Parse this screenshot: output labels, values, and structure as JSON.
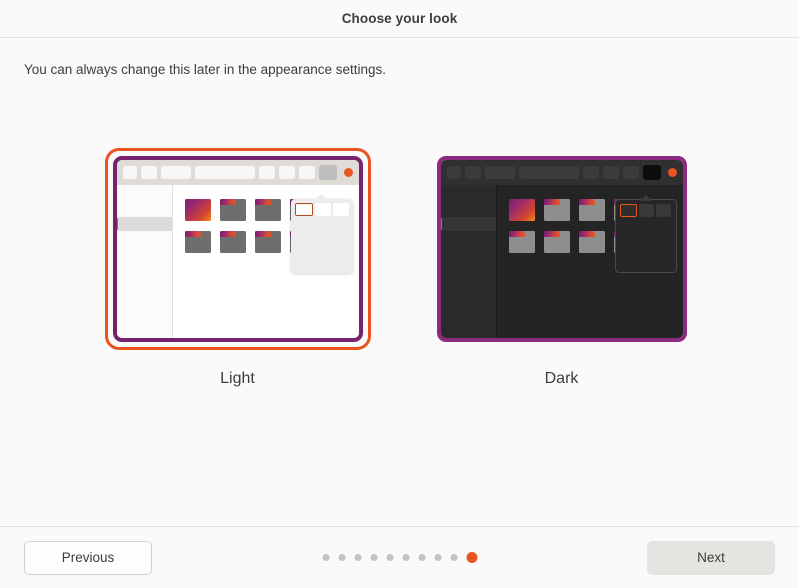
{
  "header": {
    "title": "Choose your look"
  },
  "main": {
    "subtitle": "You can always change this later in the appearance settings.",
    "options": [
      {
        "id": "light",
        "label": "Light",
        "selected": true
      },
      {
        "id": "dark",
        "label": "Dark",
        "selected": false
      }
    ]
  },
  "footer": {
    "previous_label": "Previous",
    "next_label": "Next",
    "dots": {
      "total": 10,
      "active_index": 9
    }
  },
  "colors": {
    "accent": "#e95420",
    "window_border_purple": "#77216f",
    "page_background": "#fafafa",
    "text": "#3d3d3d"
  }
}
